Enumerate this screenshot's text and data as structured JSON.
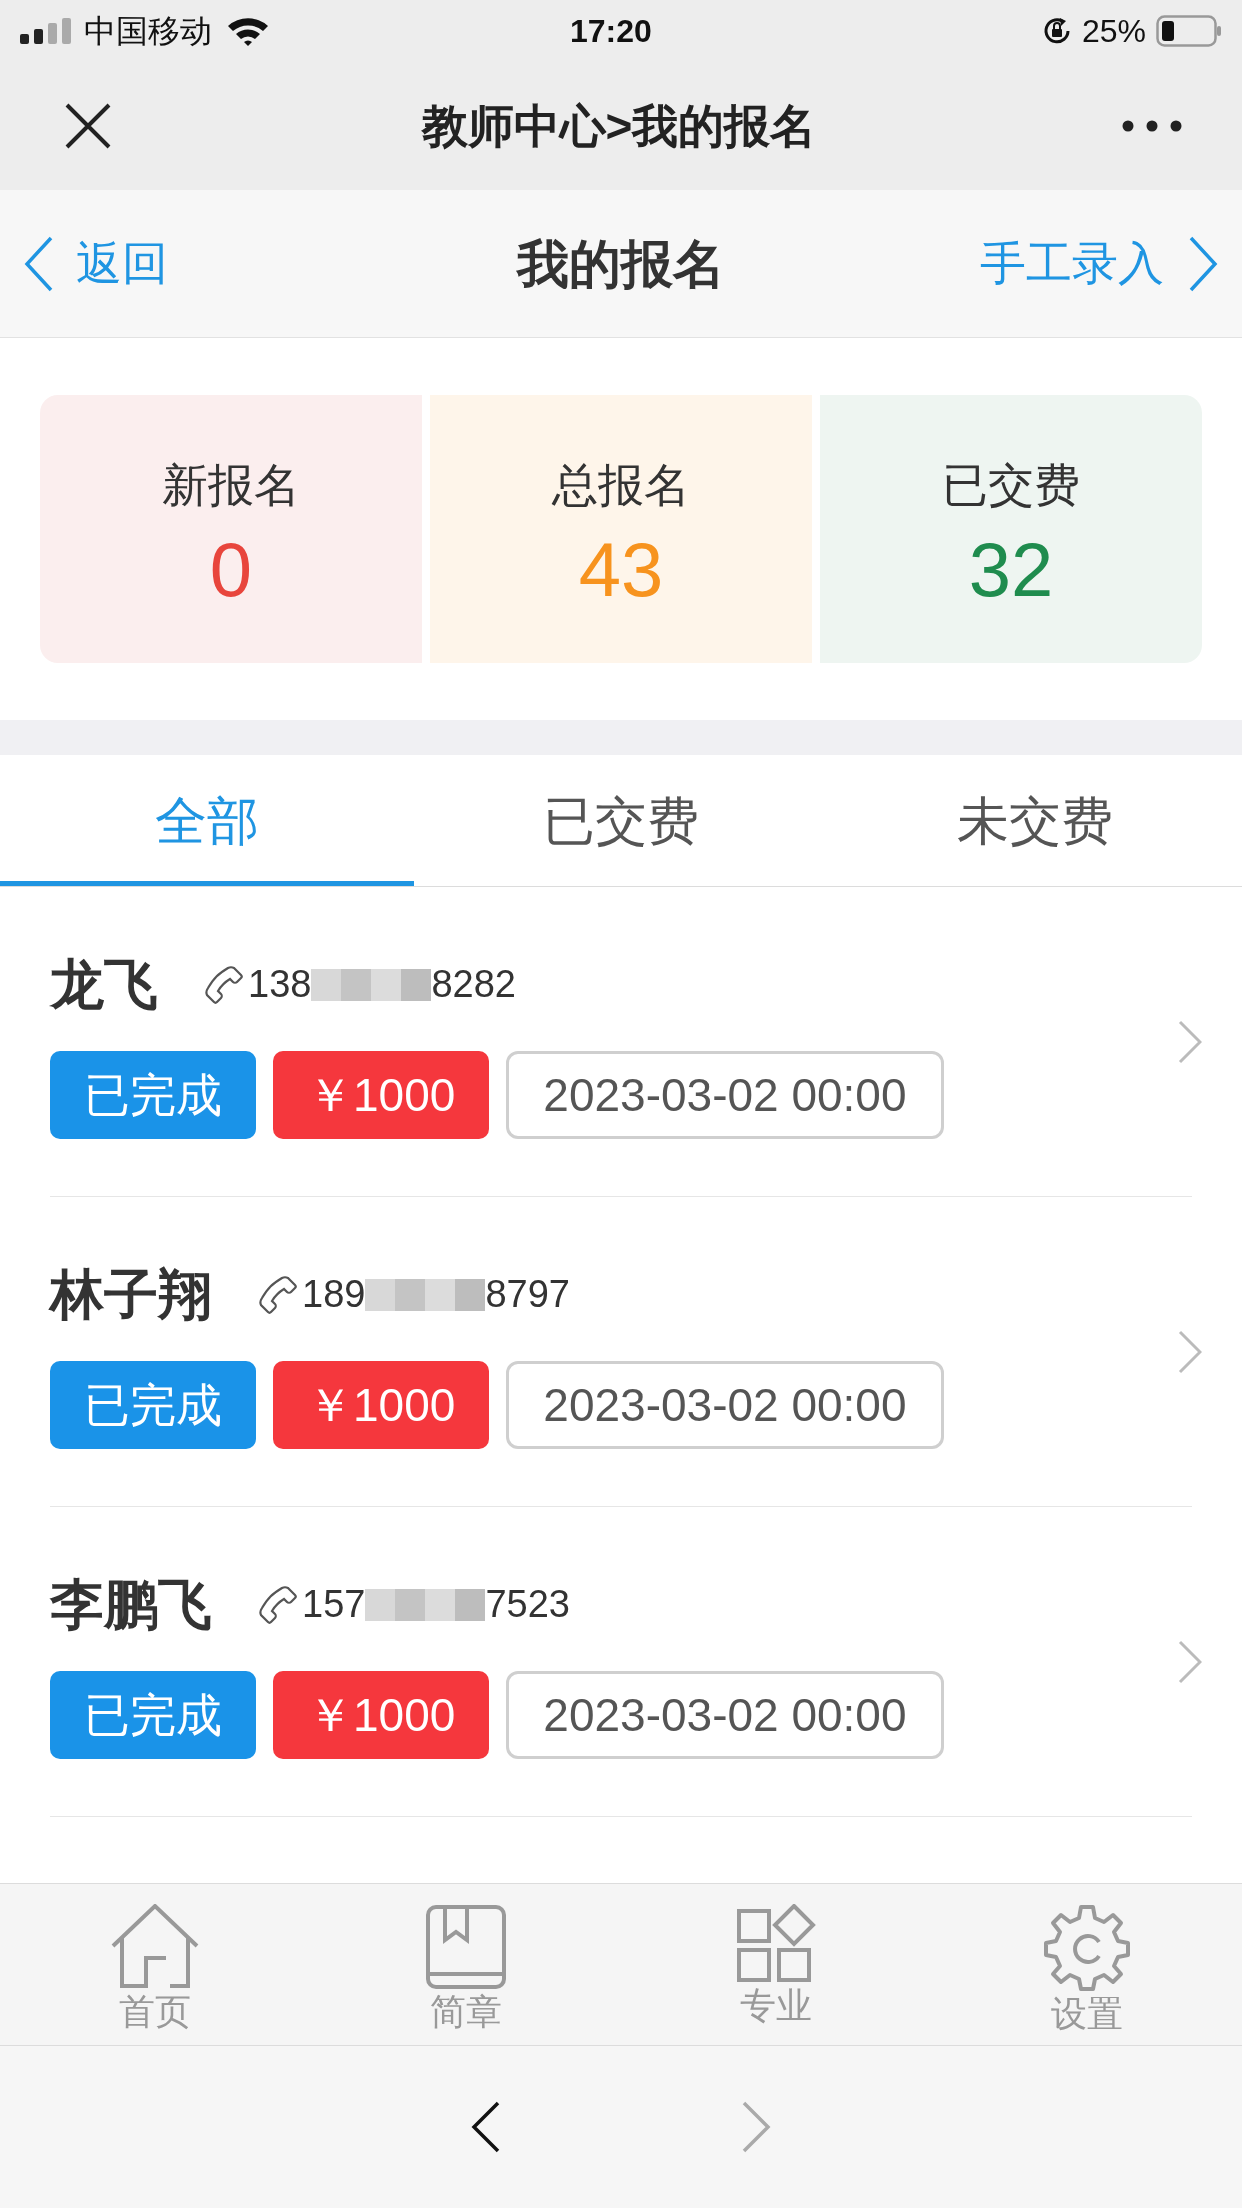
{
  "status_bar": {
    "carrier": "中国移动",
    "time": "17:20",
    "battery": "25%"
  },
  "nav_bar": {
    "title": "教师中心>我的报名"
  },
  "header": {
    "back": "返回",
    "title": "我的报名",
    "action": "手工录入"
  },
  "stats": [
    {
      "label": "新报名",
      "value": "0",
      "color": "#e8453c"
    },
    {
      "label": "总报名",
      "value": "43",
      "color": "#f7931e"
    },
    {
      "label": "已交费",
      "value": "32",
      "color": "#1f8c4e"
    }
  ],
  "tabs": [
    {
      "label": "全部",
      "selected": true
    },
    {
      "label": "已交费",
      "selected": false
    },
    {
      "label": "未交费",
      "selected": false
    }
  ],
  "rows": [
    {
      "name": "龙飞",
      "phone_start": "138",
      "phone_end": "8282",
      "status": "已完成",
      "amount": "￥1000",
      "date": "2023-03-02 00:00"
    },
    {
      "name": "林子翔",
      "phone_start": "189",
      "phone_end": "8797",
      "status": "已完成",
      "amount": "￥1000",
      "date": "2023-03-02 00:00"
    },
    {
      "name": "李鹏飞",
      "phone_start": "157",
      "phone_end": "7523",
      "status": "已完成",
      "amount": "￥1000",
      "date": "2023-03-02 00:00"
    }
  ],
  "tab_bar": [
    {
      "kind": "home",
      "label": "首页"
    },
    {
      "kind": "book",
      "label": "简章"
    },
    {
      "kind": "grid",
      "label": "专业"
    },
    {
      "kind": "gear",
      "label": "设置"
    }
  ],
  "browser_toolbar": {
    "back_disabled": false,
    "forward_disabled": true
  }
}
